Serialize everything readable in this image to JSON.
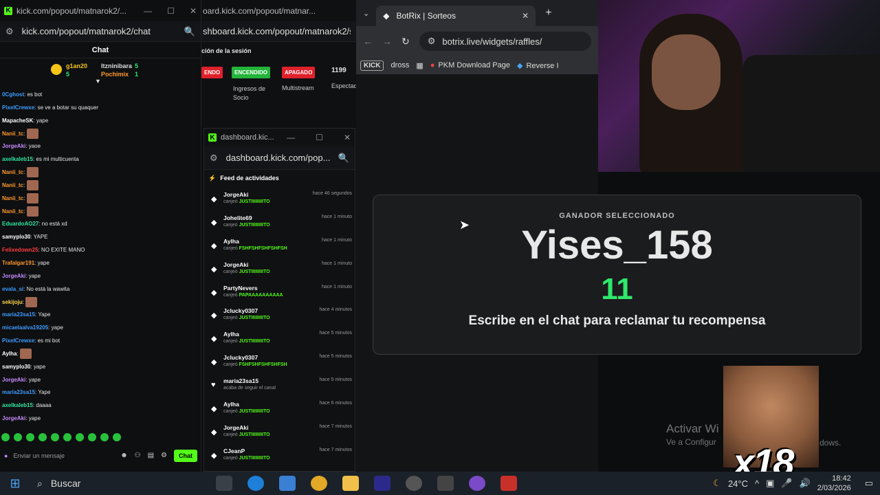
{
  "chat_window": {
    "title": "kick.com/popout/matnarok2/...",
    "url": "kick.com/popout/matnarok2/chat",
    "header": "Chat",
    "leaderboard": [
      {
        "rank": "1",
        "name": "g1an20",
        "count": "5"
      },
      {
        "rank": "2",
        "name": "Itzninibara",
        "count": "5"
      },
      {
        "rank": "3",
        "name": "Pochimix",
        "count": "1"
      }
    ],
    "messages": [
      {
        "user": "0Cghost",
        "text": "es bot",
        "color": "#3d9cff"
      },
      {
        "user": "PixelCrewxe",
        "text": "se ve a botar su quaquer",
        "color": "#3d9cff"
      },
      {
        "user": "MapacheSK",
        "text": "yape",
        "color": "#ffffff"
      },
      {
        "user": "Nanii_tc",
        "text": "",
        "color": "#ff9a2e",
        "emote": true
      },
      {
        "user": "JorgeAki",
        "text": "yaoe",
        "color": "#c98bff"
      },
      {
        "user": "axelkaleb15",
        "text": "es mi multicuenta",
        "color": "#2ee8a0"
      },
      {
        "user": "Nanii_tc",
        "text": "",
        "color": "#ff9a2e",
        "emote": true
      },
      {
        "user": "Nanii_tc",
        "text": "",
        "color": "#ff9a2e",
        "emote": true
      },
      {
        "user": "Nanii_tc",
        "text": "",
        "color": "#ff9a2e",
        "emote": true
      },
      {
        "user": "Nanii_tc",
        "text": "",
        "color": "#ff9a2e",
        "emote": true
      },
      {
        "user": "EduardoAO27",
        "text": "no está xd",
        "color": "#2ee8a0"
      },
      {
        "user": "samyplo30",
        "text": "YAPE",
        "color": "#ffffff"
      },
      {
        "user": "Felixedown25",
        "text": "NO EXITE MANO",
        "color": "#ff3d3d"
      },
      {
        "user": "Trafalgar191",
        "text": "yape",
        "color": "#ff9a2e"
      },
      {
        "user": "JorgeAki",
        "text": "yape",
        "color": "#c98bff"
      },
      {
        "user": "evala_si",
        "text": "No está la wawita",
        "color": "#3d9cff"
      },
      {
        "user": "sekijoju",
        "text": "",
        "color": "#ffd54a",
        "emote": true
      },
      {
        "user": "maria23sa15",
        "text": "Yape",
        "color": "#3d9cff"
      },
      {
        "user": "micaelaalva19205",
        "text": "yape",
        "color": "#3d9cff"
      },
      {
        "user": "PixelCrewxe",
        "text": "es mi bot",
        "color": "#3d9cff"
      },
      {
        "user": "Aylha",
        "text": "",
        "color": "#ffffff",
        "emote": true
      },
      {
        "user": "samyplo30",
        "text": "yape",
        "color": "#ffffff"
      },
      {
        "user": "JorgeAki",
        "text": "yape",
        "color": "#c98bff"
      },
      {
        "user": "maria23sa15",
        "text": "Yape",
        "color": "#3d9cff"
      },
      {
        "user": "axelkaleb15",
        "text": "daaaa",
        "color": "#2ee8a0"
      },
      {
        "user": "JorgeAki",
        "text": "yape",
        "color": "#c98bff"
      }
    ],
    "input_placeholder": "Enviar un mensaje",
    "chat_button": "Chat"
  },
  "dashboard_window": {
    "title": "oard.kick.com/popout/matnar...",
    "url": "shboard.kick.com/popout/matnarok2/s",
    "section": "ción de la sesión",
    "tags": [
      "ENDO",
      "ENCENDIDO",
      "APAGADO"
    ],
    "count": "1199",
    "labels": [
      "Ingresos de Socio",
      "Multistream",
      "Espectad"
    ]
  },
  "feed_window": {
    "title": "dashboard.kic...",
    "url": "dashboard.kick.com/pop...",
    "header": "Feed de actividades",
    "items": [
      {
        "user": "JorgeAki",
        "action": "canjeó",
        "reward": "JUSTIIIIIIIIITO",
        "time": "hace 46 segundos",
        "icon": "◆"
      },
      {
        "user": "Johelite69",
        "action": "canjeó",
        "reward": "JUSTIIIIIIIIITO",
        "time": "hace 1 minuto",
        "icon": "◆"
      },
      {
        "user": "Aylha",
        "action": "canjeó",
        "reward": "FSHFSHFSHFSHFSH",
        "time": "hace 1 minuto",
        "icon": "◆"
      },
      {
        "user": "JorgeAki",
        "action": "canjeó",
        "reward": "JUSTIIIIIIIIITO",
        "time": "hace 1 minuto",
        "icon": "◆"
      },
      {
        "user": "PartyNevers",
        "action": "canjeó",
        "reward": "PAPAAAAAAAAAA",
        "time": "hace 1 minuto",
        "icon": "◆"
      },
      {
        "user": "Jclucky0307",
        "action": "canjeó",
        "reward": "JUSTIIIIIIIIITO",
        "time": "hace 4 minutos",
        "icon": "◆"
      },
      {
        "user": "Aylha",
        "action": "canjeó",
        "reward": "JUSTIIIIIIIIITO",
        "time": "hace 5 minutos",
        "icon": "◆"
      },
      {
        "user": "Jclucky0307",
        "action": "canjeó",
        "reward": "FSHFSHFSHFSHFSH",
        "time": "hace 5 minutos",
        "icon": "◆"
      },
      {
        "user": "maria23sa15",
        "action": "acaba de seguir el canal",
        "reward": "",
        "time": "hace 5 minutos",
        "icon": "♥"
      },
      {
        "user": "Aylha",
        "action": "canjeó",
        "reward": "JUSTIIIIIIIIITO",
        "time": "hace 6 minutos",
        "icon": "◆"
      },
      {
        "user": "JorgeAki",
        "action": "canjeó",
        "reward": "JUSTIIIIIIIIITO",
        "time": "hace 7 minutos",
        "icon": "◆"
      },
      {
        "user": "CJeanP",
        "action": "canjeó",
        "reward": "JUSTIIIIIIIIITO",
        "time": "hace 7 minutos",
        "icon": "◆"
      }
    ]
  },
  "browser": {
    "tab_title": "BotRix | Sorteos",
    "url": "botrix.live/widgets/raffles/",
    "bookmarks": [
      "KICK",
      "dross",
      "PKM Download Page",
      "Reverse I"
    ]
  },
  "winner_card": {
    "subtitle": "GANADOR SELECCIONADO",
    "name": "Yises_158",
    "count": "11",
    "message": "Escribe en el chat para reclamar tu recompensa"
  },
  "overlay": {
    "badge": "x18",
    "watermark_line1": "Activar Wi",
    "watermark_line2": "Ve a Configur",
    "watermark_tail": "dows."
  },
  "taskbar": {
    "search": "Buscar",
    "weather": "24°C",
    "time": "18:42",
    "date": "2/03/2026"
  }
}
